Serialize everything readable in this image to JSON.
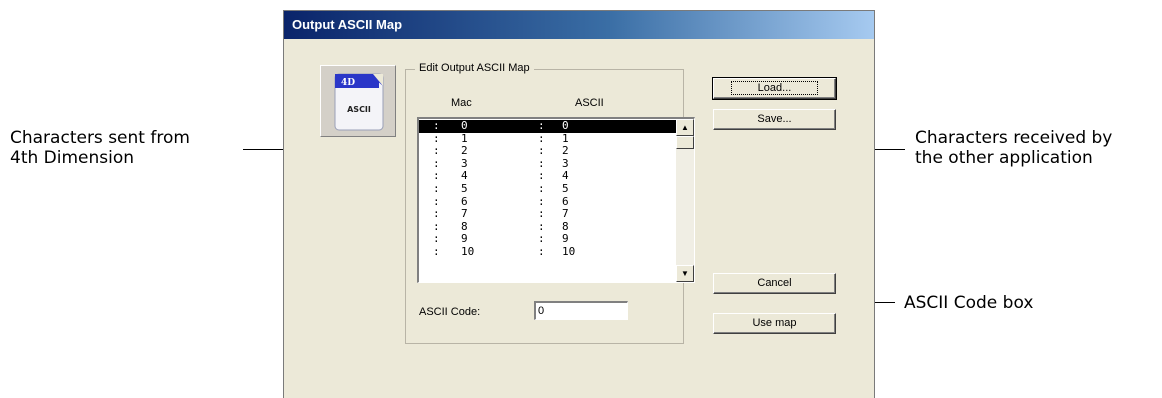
{
  "callouts": {
    "left": "Characters sent from\n4th Dimension",
    "right": "Characters received by\nthe other application",
    "code_box": "ASCII Code box"
  },
  "dialog": {
    "title": "Output ASCII Map",
    "logo_badge": "4D",
    "logo_text": "ASCII",
    "group_label": "Edit Output ASCII Map",
    "col_mac": "Mac",
    "col_ascii": "ASCII",
    "rows": [
      {
        "mac": "0",
        "ascii": "0"
      },
      {
        "mac": "1",
        "ascii": "1"
      },
      {
        "mac": "2",
        "ascii": "2"
      },
      {
        "mac": "3",
        "ascii": "3"
      },
      {
        "mac": "4",
        "ascii": "4"
      },
      {
        "mac": "5",
        "ascii": "5"
      },
      {
        "mac": "6",
        "ascii": "6"
      },
      {
        "mac": "7",
        "ascii": "7"
      },
      {
        "mac": "8",
        "ascii": "8"
      },
      {
        "mac": "9",
        "ascii": "9"
      },
      {
        "mac": "10",
        "ascii": "10"
      }
    ],
    "separator": ":",
    "selected_row": 0,
    "ascii_code_label": "ASCII Code:",
    "ascii_code_value": "0",
    "buttons": {
      "load": "Load...",
      "save": "Save...",
      "cancel": "Cancel",
      "use_map": "Use map"
    }
  }
}
